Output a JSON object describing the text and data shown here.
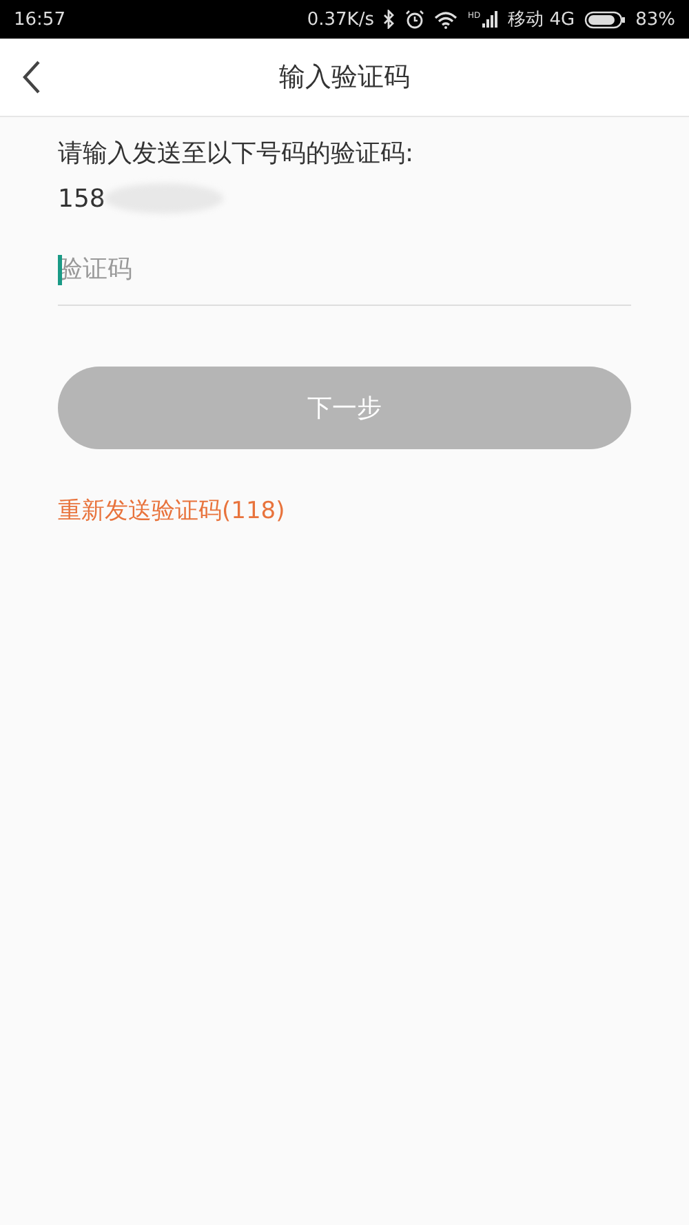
{
  "status_bar": {
    "time": "16:57",
    "speed": "0.37K/s",
    "signal_badge": "HD",
    "carrier": "移动 4G",
    "battery": "83%"
  },
  "header": {
    "title": "输入验证码"
  },
  "prompt": "请输入发送至以下号码的验证码:",
  "phone": "158",
  "code_field": {
    "placeholder": "验证码",
    "focused": true
  },
  "next_button": {
    "label": "下一步",
    "disabled": true
  },
  "resend_link": "重新发送验证码(118)"
}
